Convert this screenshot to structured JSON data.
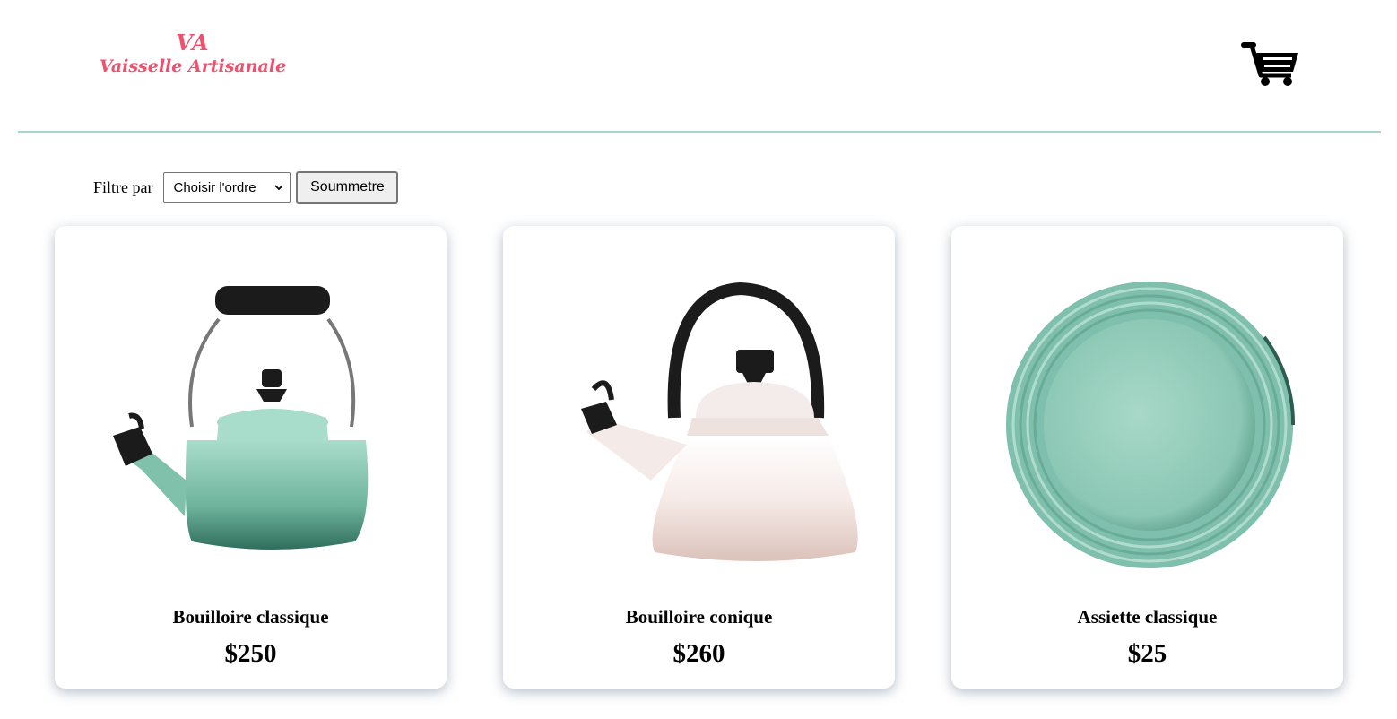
{
  "header": {
    "logo_monogram": "VA",
    "logo_name": "Vaisselle Artisanale",
    "cart_icon": "shopping-cart-icon",
    "accent_color": "#f0506e",
    "divider_color": "#a8d5cc"
  },
  "filter": {
    "label": "Filtre par",
    "select_value": "Choisir l'ordre",
    "submit_label": "Soummetre"
  },
  "products": [
    {
      "title": "Bouilloire classique",
      "price": "$250",
      "image": "mint-classic-kettle",
      "color": "#8cc9b5"
    },
    {
      "title": "Bouilloire conique",
      "price": "$260",
      "image": "pink-conical-kettle",
      "color": "#f1e2dd"
    },
    {
      "title": "Assiette classique",
      "price": "$25",
      "image": "mint-plate",
      "color": "#8fcbb9"
    }
  ]
}
